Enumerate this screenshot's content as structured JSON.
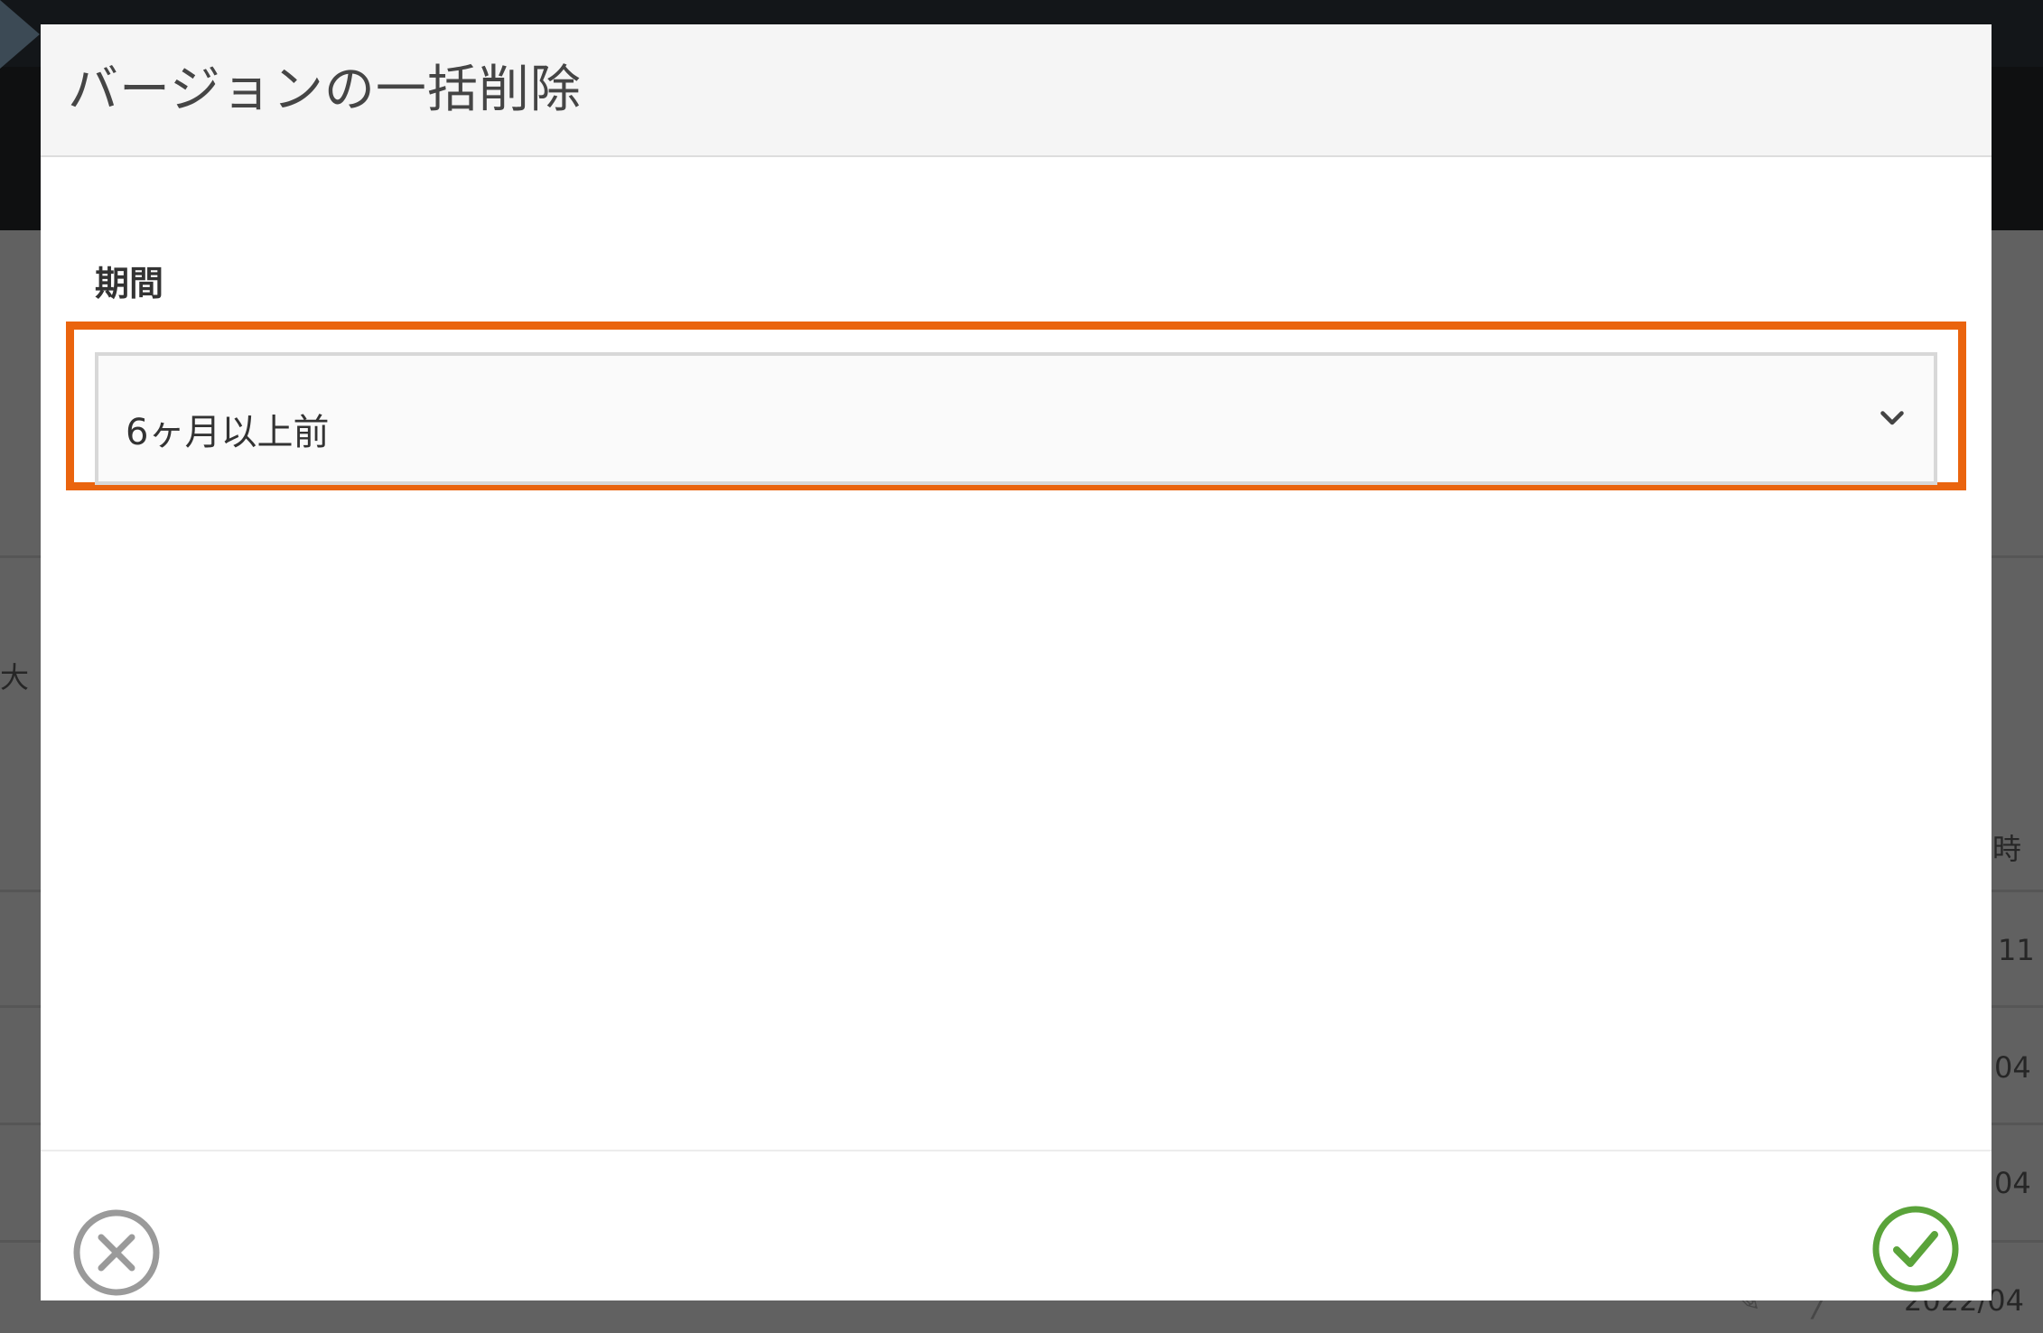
{
  "dialog": {
    "title": "バージョンの一括削除",
    "field_label": "期間",
    "select": {
      "value": "6ヶ月以上前",
      "icon": "chevron-down-icon"
    },
    "cancel_icon": "close-circle-icon",
    "confirm_icon": "check-circle-icon",
    "highlight_color": "#ea640e",
    "confirm_color": "#5aa33a",
    "cancel_color": "#9a9a9a"
  },
  "background": {
    "left_text": "大",
    "header_fragment": "時",
    "rows": [
      "11",
      "04",
      "04",
      "2022/04"
    ]
  }
}
